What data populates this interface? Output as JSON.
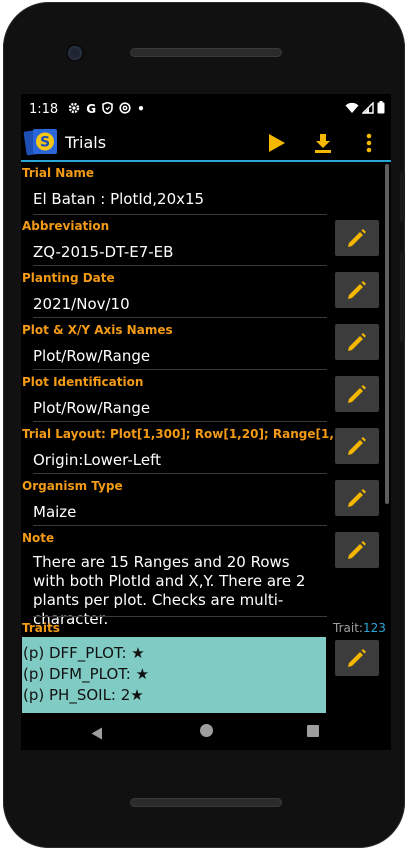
{
  "status_bar": {
    "time": "1:18",
    "icons": [
      "gear-icon",
      "google-icon",
      "shield-icon",
      "at-icon",
      "dot-icon"
    ],
    "right_icons": [
      "wifi-icon",
      "signal-icon",
      "battery-icon"
    ]
  },
  "app_bar": {
    "title": "Trials",
    "actions": [
      "play-icon",
      "download-icon",
      "overflow-menu-icon"
    ],
    "accent_color": "#29a8d8",
    "action_color": "#f5b800"
  },
  "fields": [
    {
      "label": "Trial Name",
      "value": "El Batan : PlotId,20x15",
      "editable": false
    },
    {
      "label": "Abbreviation",
      "value": "ZQ-2015-DT-E7-EB",
      "editable": true
    },
    {
      "label": "Planting Date",
      "value": "2021/Nov/10",
      "editable": true
    },
    {
      "label": "Plot & X/Y Axis Names",
      "value": "Plot/Row/Range",
      "editable": true
    },
    {
      "label": "Plot Identification",
      "value": "Plot/Row/Range",
      "editable": true
    },
    {
      "label": "Trial Layout: Plot[1,300]; Row[1,20]; Range[1,15]",
      "value": "Origin:Lower-Left",
      "editable": true
    },
    {
      "label": "Organism Type",
      "value": "Maize",
      "editable": true
    }
  ],
  "note": {
    "label": "Note",
    "value": "There are 15 Ranges and 20 Rows with both PlotId and X,Y. There are 2 plants per plot. Checks are multi-character."
  },
  "traits": {
    "label": "Traits",
    "count_prefix": "Trait:",
    "count": "123",
    "items": [
      "(p)  DFF_PLOT: ★",
      "(p)  DFM_PLOT: ★",
      "(p)  PH_SOIL: 2★"
    ],
    "box_color": "#80cbc4"
  },
  "colors": {
    "label": "#f39a16",
    "edit_button_bg": "#3c3c3c",
    "pencil": "#f5b800"
  }
}
